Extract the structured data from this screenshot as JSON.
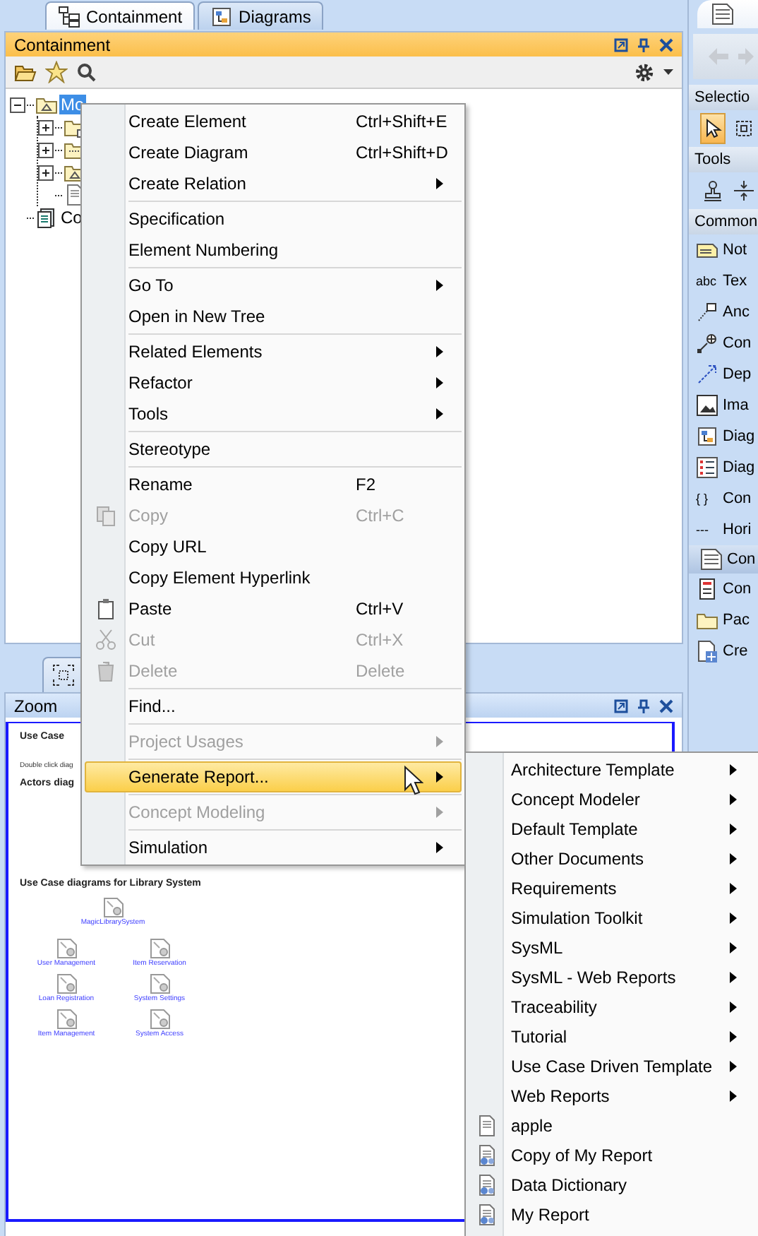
{
  "left_tabs": [
    {
      "label": "Containment",
      "selected": true
    },
    {
      "label": "Diagrams",
      "selected": false
    }
  ],
  "containment": {
    "title": "Containment",
    "tree": [
      {
        "label": "Mo",
        "kind": "model",
        "expanded": true,
        "selected": true,
        "children": [
          {
            "kind": "package",
            "expanded": false
          },
          {
            "kind": "profile",
            "expanded": false
          },
          {
            "kind": "model",
            "expanded": false
          },
          {
            "kind": "document"
          }
        ]
      },
      {
        "label": "Co",
        "kind": "catalog",
        "selected": false
      }
    ]
  },
  "zoom": {
    "title": "Zoom",
    "heading": "Use Case",
    "note": "Double click diag",
    "section": "Actors diag",
    "subheading": "Use Case diagrams for Library System",
    "links": [
      {
        "label": "MagicLibrarySystem"
      },
      {
        "label": "User Management"
      },
      {
        "label": "Item Reservation"
      },
      {
        "label": "Loan Registration"
      },
      {
        "label": "System Settings"
      },
      {
        "label": "Item Management"
      },
      {
        "label": "System Access"
      }
    ]
  },
  "palette": {
    "sections": [
      {
        "title": "Selectio",
        "kind": "tools",
        "items": [
          {
            "kind": "pointer",
            "selected": true
          },
          {
            "kind": "marquee",
            "selected": false
          }
        ]
      },
      {
        "title": "Tools",
        "kind": "tools",
        "items": [
          {
            "kind": "stamp",
            "selected": false
          },
          {
            "kind": "split",
            "selected": false
          }
        ]
      },
      {
        "title": "Common",
        "kind": "list",
        "items": [
          {
            "kind": "note",
            "label": "Not"
          },
          {
            "kind": "glyph",
            "icon_text": "abc",
            "label": "Tex"
          },
          {
            "kind": "anchor",
            "label": "Anc"
          },
          {
            "kind": "connector",
            "label": "Con"
          },
          {
            "kind": "dependency",
            "label": "Dep"
          },
          {
            "kind": "image",
            "label": "Ima"
          },
          {
            "kind": "diagram",
            "label": "Diag"
          },
          {
            "kind": "list",
            "label": "Diag"
          },
          {
            "kind": "glyph",
            "icon_text": "{ }",
            "label": "Con"
          },
          {
            "kind": "glyph",
            "icon_text": "---",
            "label": "Hori"
          }
        ]
      },
      {
        "title": "Con",
        "kind": "group",
        "items": [
          {
            "kind": "form",
            "label": "Con"
          },
          {
            "kind": "folder",
            "label": "Pac"
          },
          {
            "kind": "add-document",
            "label": "Cre"
          }
        ]
      }
    ]
  },
  "context_menu": {
    "groups": [
      [
        {
          "label": "Create Element",
          "shortcut": "Ctrl+Shift+E",
          "submenu": false,
          "disabled": false,
          "selected": false
        },
        {
          "label": "Create Diagram",
          "shortcut": "Ctrl+Shift+D",
          "submenu": false,
          "disabled": false,
          "selected": false
        },
        {
          "label": "Create Relation",
          "submenu": true,
          "disabled": false,
          "selected": false
        }
      ],
      [
        {
          "label": "Specification",
          "submenu": false,
          "disabled": false,
          "selected": false
        },
        {
          "label": "Element Numbering",
          "submenu": false,
          "disabled": false,
          "selected": false
        }
      ],
      [
        {
          "label": "Go To",
          "submenu": true,
          "disabled": false,
          "selected": false
        },
        {
          "label": "Open in New Tree",
          "submenu": false,
          "disabled": false,
          "selected": false
        }
      ],
      [
        {
          "label": "Related Elements",
          "submenu": true,
          "disabled": false,
          "selected": false
        },
        {
          "label": "Refactor",
          "submenu": true,
          "disabled": false,
          "selected": false
        },
        {
          "label": "Tools",
          "submenu": true,
          "disabled": false,
          "selected": false
        }
      ],
      [
        {
          "label": "Stereotype",
          "submenu": false,
          "disabled": false,
          "selected": false
        }
      ],
      [
        {
          "label": "Rename",
          "shortcut": "F2",
          "submenu": false,
          "disabled": false,
          "selected": false
        },
        {
          "label": "Copy",
          "kind": "copy",
          "shortcut": "Ctrl+C",
          "submenu": false,
          "disabled": true,
          "selected": false
        },
        {
          "label": "Copy URL",
          "submenu": false,
          "disabled": false,
          "selected": false
        },
        {
          "label": "Copy Element Hyperlink",
          "submenu": false,
          "disabled": false,
          "selected": false
        },
        {
          "label": "Paste",
          "kind": "paste",
          "shortcut": "Ctrl+V",
          "submenu": false,
          "disabled": false,
          "selected": false
        },
        {
          "label": "Cut",
          "kind": "cut",
          "shortcut": "Ctrl+X",
          "submenu": false,
          "disabled": true,
          "selected": false
        },
        {
          "label": "Delete",
          "kind": "delete",
          "shortcut": "Delete",
          "submenu": false,
          "disabled": true,
          "selected": false
        }
      ],
      [
        {
          "label": "Find...",
          "submenu": false,
          "disabled": false,
          "selected": false
        }
      ],
      [
        {
          "label": "Project Usages",
          "submenu": true,
          "disabled": true,
          "selected": false
        }
      ],
      [
        {
          "label": "Generate Report...",
          "submenu": true,
          "disabled": false,
          "selected": true
        }
      ],
      [
        {
          "label": "Concept Modeling",
          "submenu": true,
          "disabled": true,
          "selected": false
        }
      ],
      [
        {
          "label": "Simulation",
          "submenu": true,
          "disabled": false,
          "selected": false
        }
      ]
    ]
  },
  "report_menu": {
    "items": [
      {
        "label": "Architecture Template",
        "kind": "submenu"
      },
      {
        "label": "Concept Modeler",
        "kind": "submenu"
      },
      {
        "label": "Default Template",
        "kind": "submenu"
      },
      {
        "label": "Other Documents",
        "kind": "submenu"
      },
      {
        "label": "Requirements",
        "kind": "submenu"
      },
      {
        "label": "Simulation Toolkit",
        "kind": "submenu"
      },
      {
        "label": "SysML",
        "kind": "submenu"
      },
      {
        "label": "SysML - Web Reports",
        "kind": "submenu"
      },
      {
        "label": "Traceability",
        "kind": "submenu"
      },
      {
        "label": "Tutorial",
        "kind": "submenu"
      },
      {
        "label": "Use Case Driven Template",
        "kind": "submenu"
      },
      {
        "label": "Web Reports",
        "kind": "submenu"
      },
      {
        "label": "apple",
        "kind": "document"
      },
      {
        "label": "Copy of My Report",
        "kind": "report"
      },
      {
        "label": "Data Dictionary",
        "kind": "report"
      },
      {
        "label": "My Report",
        "kind": "report"
      }
    ]
  }
}
